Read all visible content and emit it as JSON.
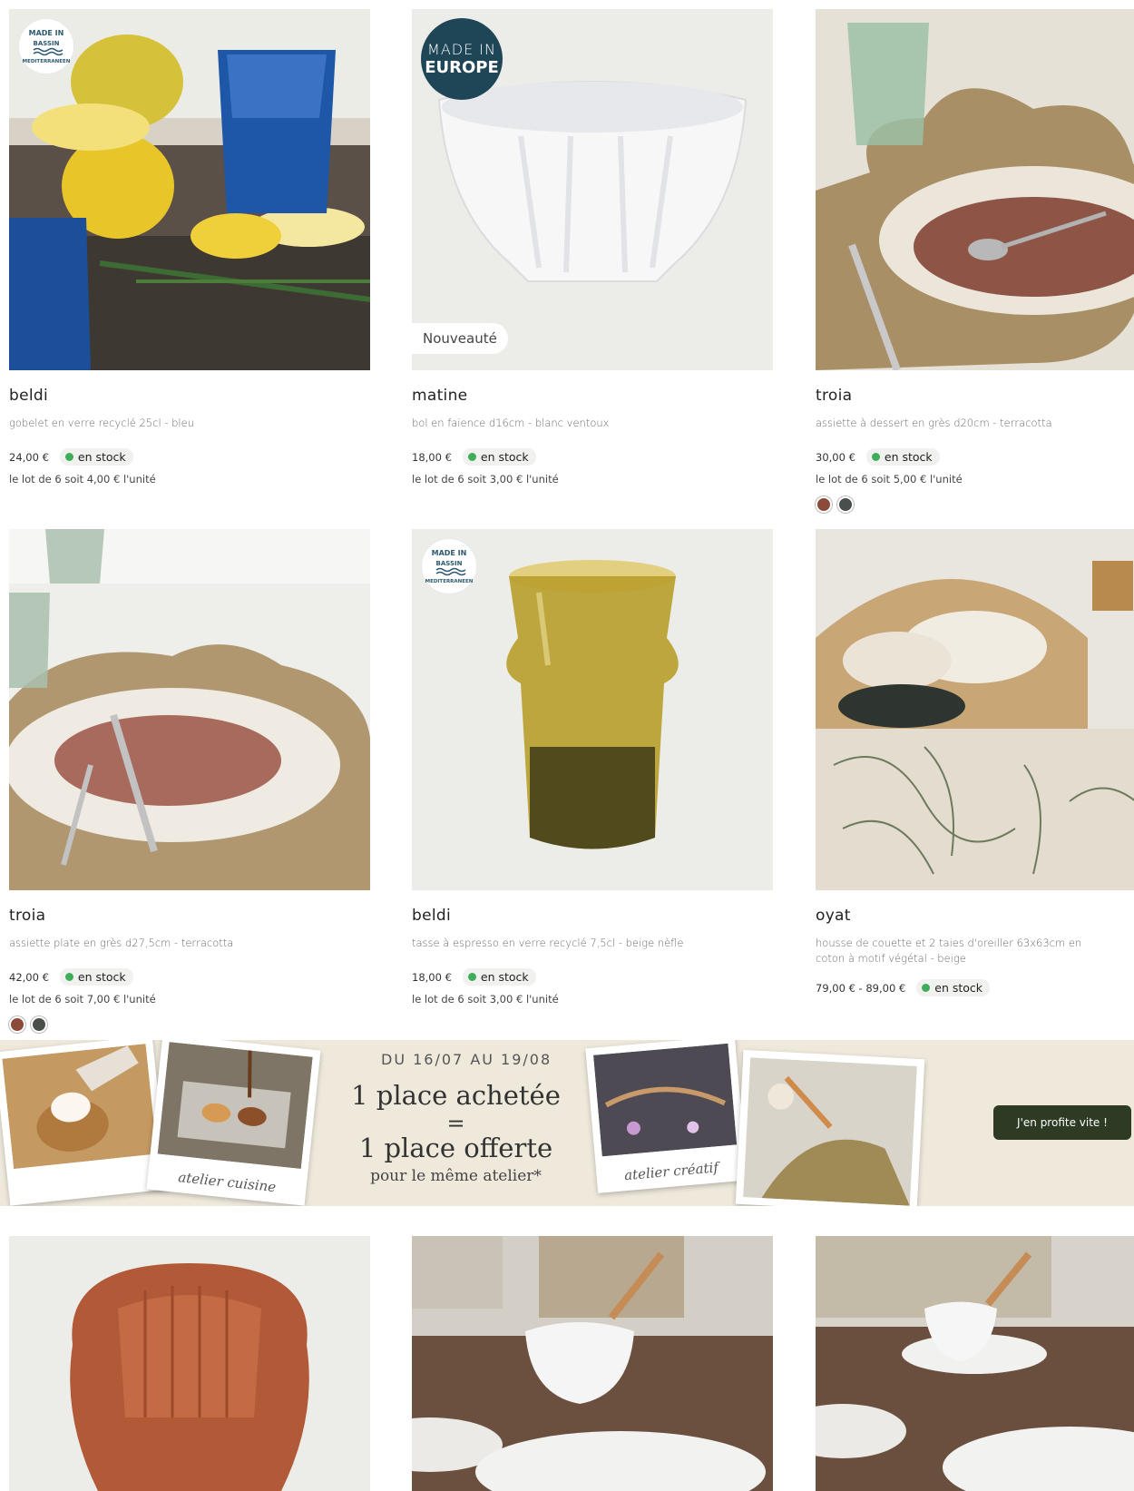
{
  "products": [
    {
      "name": "beldi",
      "desc": "gobelet en verre recyclé 25cl - bleu",
      "price": "24,00 €",
      "stock": "en stock",
      "unit": "le lot de 6 soit 4,00 € l'unité",
      "badge_med": "MADE IN BASSIN MEDITERRANEEN"
    },
    {
      "name": "matine",
      "desc": "bol en faïence d16cm - blanc ventoux",
      "price": "18,00 €",
      "stock": "en stock",
      "unit": "le lot de 6 soit 3,00 € l'unité",
      "badge_eu_l1": "MADE IN",
      "badge_eu_l2": "EUROPE",
      "badge_new": "Nouveauté"
    },
    {
      "name": "troia",
      "desc": "assiette à dessert en grès d20cm - terracotta",
      "price": "30,00 €",
      "stock": "en stock",
      "unit": "le lot de 6 soit 5,00 € l'unité",
      "swatches": [
        "#8c4a3a",
        "#4a4f4c"
      ]
    },
    {
      "name": "troia",
      "desc": "assiette plate en grès d27,5cm - terracotta",
      "price": "42,00 €",
      "stock": "en stock",
      "unit": "le lot de 6 soit 7,00 € l'unité",
      "swatches": [
        "#8c4a3a",
        "#4a4f4c"
      ]
    },
    {
      "name": "beldi",
      "desc": "tasse à espresso en verre recyclé 7,5cl - beige nèfle",
      "price": "18,00 €",
      "stock": "en stock",
      "unit": "le lot de 6 soit 3,00 € l'unité",
      "badge_med": "MADE IN BASSIN MEDITERRANEEN"
    },
    {
      "name": "oyat",
      "desc": "housse de couette et 2 taies d'oreiller 63x63cm en coton à motif végétal - beige",
      "price": "79,00 € - 89,00 €",
      "stock": "en stock"
    }
  ],
  "banner": {
    "date": "DU 16/07 AU 19/08",
    "line1": "1 place achetée",
    "equals": "=",
    "line2": "1 place offerte",
    "line3": "pour le même atelier*",
    "caption_left": "atelier cuisine",
    "caption_right": "atelier créatif",
    "cta": "J'en profite vite !"
  },
  "colors": {
    "stock_dot": "#3fae5a",
    "badge_eu": "#1f4657",
    "cta": "#2d3a24"
  }
}
